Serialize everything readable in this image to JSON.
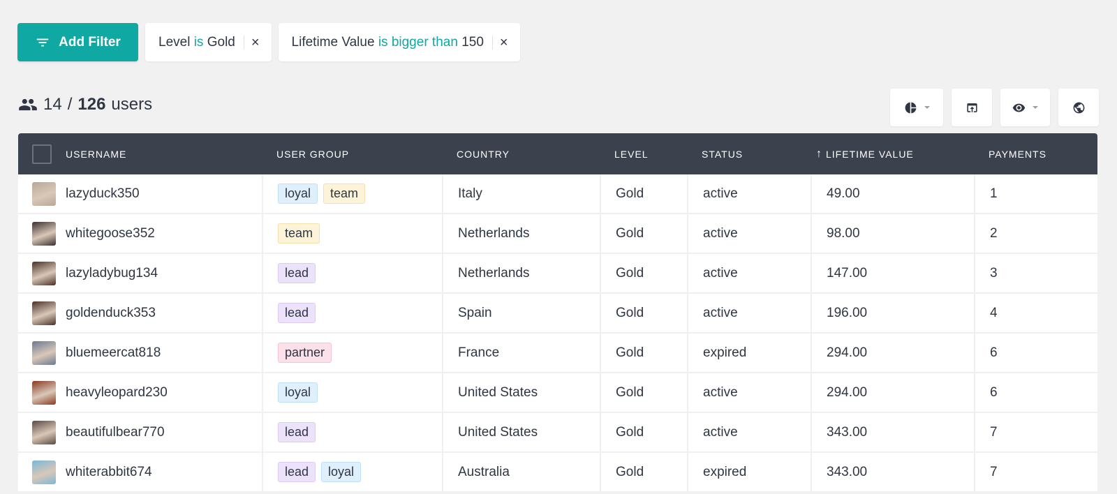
{
  "filters": {
    "add_filter_label": "Add Filter",
    "chips": [
      {
        "field": "Level",
        "operator": "is",
        "value": "Gold"
      },
      {
        "field": "Lifetime Value",
        "operator": "is bigger than",
        "value": "150"
      }
    ],
    "remove_glyph": "×"
  },
  "summary": {
    "shown": "14",
    "separator": "/",
    "total": "126",
    "unit": "users"
  },
  "toolbar": [
    "chart-icon",
    "export-icon",
    "visibility-icon",
    "globe-icon"
  ],
  "colors": {
    "accent": "#10a8a3",
    "header_bg": "#3b424d",
    "page_bg": "#f1f1f1"
  },
  "table": {
    "columns": [
      "USERNAME",
      "USER GROUP",
      "COUNTRY",
      "LEVEL",
      "STATUS",
      "LIFETIME VALUE",
      "PAYMENTS"
    ],
    "sort_indicator": "↑",
    "rows": [
      {
        "username": "lazyduck350",
        "groups": [
          "loyal",
          "team"
        ],
        "country": "Italy",
        "level": "Gold",
        "status": "active",
        "ltv": "49.00",
        "payments": "1",
        "avatar": "#b9a899"
      },
      {
        "username": "whitegoose352",
        "groups": [
          "team"
        ],
        "country": "Netherlands",
        "level": "Gold",
        "status": "active",
        "ltv": "98.00",
        "payments": "2",
        "avatar": "#3a3030"
      },
      {
        "username": "lazyladybug134",
        "groups": [
          "lead"
        ],
        "country": "Netherlands",
        "level": "Gold",
        "status": "active",
        "ltv": "147.00",
        "payments": "3",
        "avatar": "#4a3028"
      },
      {
        "username": "goldenduck353",
        "groups": [
          "lead"
        ],
        "country": "Spain",
        "level": "Gold",
        "status": "active",
        "ltv": "196.00",
        "payments": "4",
        "avatar": "#4a3028"
      },
      {
        "username": "bluemeercat818",
        "groups": [
          "partner"
        ],
        "country": "France",
        "level": "Gold",
        "status": "expired",
        "ltv": "294.00",
        "payments": "6",
        "avatar": "#6b7a90"
      },
      {
        "username": "heavyleopard230",
        "groups": [
          "loyal"
        ],
        "country": "United States",
        "level": "Gold",
        "status": "active",
        "ltv": "294.00",
        "payments": "6",
        "avatar": "#8a3a22"
      },
      {
        "username": "beautifulbear770",
        "groups": [
          "lead"
        ],
        "country": "United States",
        "level": "Gold",
        "status": "active",
        "ltv": "343.00",
        "payments": "7",
        "avatar": "#5a4a40"
      },
      {
        "username": "whiterabbit674",
        "groups": [
          "lead",
          "loyal"
        ],
        "country": "Australia",
        "level": "Gold",
        "status": "expired",
        "ltv": "343.00",
        "payments": "7",
        "avatar": "#7ab8d8"
      }
    ]
  }
}
